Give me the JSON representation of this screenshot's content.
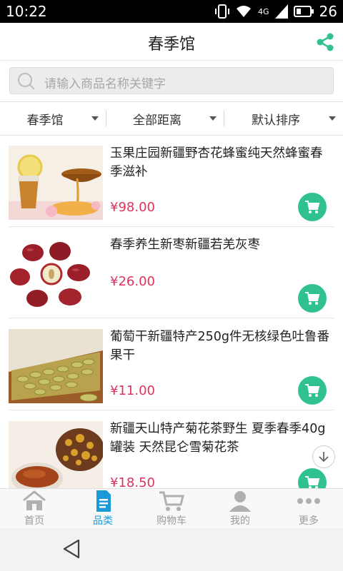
{
  "status_bar": {
    "time": "10:22",
    "network": "4G",
    "battery": "26"
  },
  "header": {
    "title": "春季馆",
    "share_icon": "share-icon"
  },
  "search": {
    "placeholder": "请输入商品名称关键字",
    "icon": "search-icon"
  },
  "filters": [
    {
      "label": "春季馆"
    },
    {
      "label": "全部距离"
    },
    {
      "label": "默认排序"
    }
  ],
  "products": [
    {
      "name": "玉果庄园新疆野杏花蜂蜜纯天然蜂蜜春季滋补",
      "price": "¥98.00",
      "image": "honey-jar-photo"
    },
    {
      "name": "春季养生新枣新疆若羌灰枣",
      "price": "¥26.00",
      "image": "red-dates-photo"
    },
    {
      "name": "葡萄干新疆特产250g件无核绿色吐鲁番果干",
      "price": "¥11.00",
      "image": "green-raisins-photo"
    },
    {
      "name": "新疆天山特产菊花茶野生 夏季春季40g罐装 天然昆仑雪菊花茶",
      "price": "¥18.50",
      "image": "chrysanthemum-tea-photo"
    }
  ],
  "tabbar": [
    {
      "label": "首页",
      "icon": "home-icon",
      "active": false
    },
    {
      "label": "品类",
      "icon": "category-icon",
      "active": true
    },
    {
      "label": "购物车",
      "icon": "cart-icon",
      "active": false
    },
    {
      "label": "我的",
      "icon": "profile-icon",
      "active": false
    },
    {
      "label": "更多",
      "icon": "more-icon",
      "active": false
    }
  ],
  "colors": {
    "accent_green": "#2fc290",
    "price_red": "#e0335c",
    "tab_active": "#1a9bd7",
    "tab_inactive": "#9a9a9a"
  }
}
